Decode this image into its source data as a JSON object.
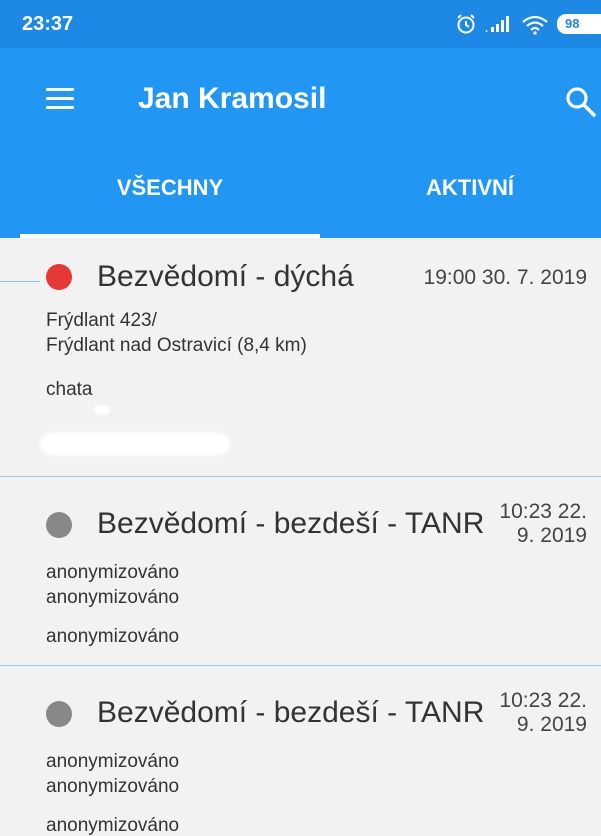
{
  "status_bar": {
    "time": "23:37",
    "battery": "98",
    "icons": [
      "alarm-icon",
      "signal-icon",
      "wifi-icon",
      "battery-icon"
    ]
  },
  "app_bar": {
    "title": "Jan Kramosil",
    "menu_icon": "menu-icon",
    "search_icon": "search-icon"
  },
  "tabs": [
    {
      "label": "VŠECHNY",
      "selected": true
    },
    {
      "label": "AKTIVNÍ",
      "selected": false
    }
  ],
  "incidents": [
    {
      "title": "Bezvědomí - dýchá",
      "date_line1": "19:00 30. 7. 2019",
      "date_line2": "",
      "address_line1": "Frýdlant 423/",
      "address_line2": "Frýdlant nad Ostravicí (8,4 km)",
      "note": "chata",
      "status_color": "#e53935"
    },
    {
      "title": "Bezvědomí - bezdeší - TANR",
      "date_line1": "10:23 22.",
      "date_line2": "9. 2019",
      "address_line1": "anonymizováno",
      "address_line2": "anonymizováno",
      "note": "anonymizováno",
      "status_color": "#888888"
    },
    {
      "title": "Bezvědomí - bezdeší - TANR",
      "date_line1": "10:23 22.",
      "date_line2": "9. 2019",
      "address_line1": "anonymizováno",
      "address_line2": "anonymizováno",
      "note": "anonymizováno",
      "status_color": "#888888"
    }
  ],
  "colors": {
    "status_bar": "#1e88e5",
    "app_bar": "#2196f3",
    "list_background": "#f2f2f2",
    "divider": "#9ec9ef"
  }
}
